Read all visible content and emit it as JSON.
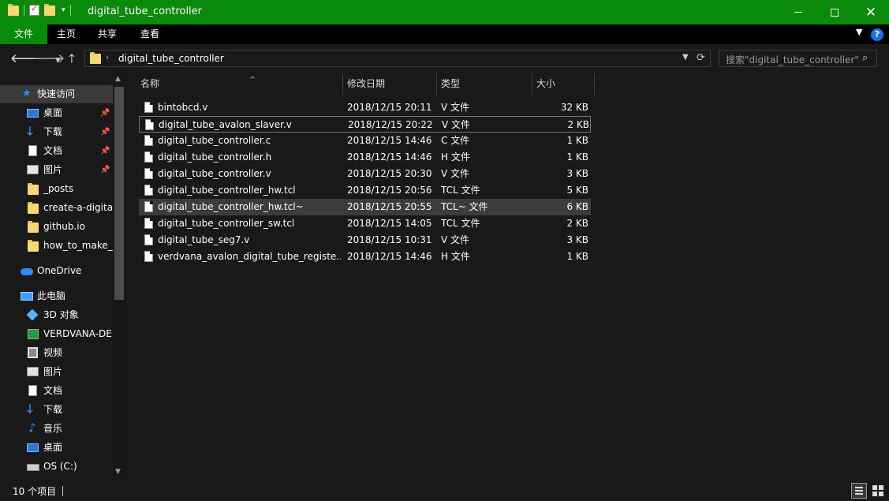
{
  "window": {
    "title": "digital_tube_controller",
    "close_glyph": "✕"
  },
  "ribbon": {
    "tabs": [
      "文件",
      "主页",
      "共享",
      "查看"
    ],
    "help": "?"
  },
  "address": {
    "path": "digital_tube_controller",
    "search_placeholder": "搜索\"digital_tube_controller\""
  },
  "sidebar": {
    "quick_access": "快速访问",
    "pinned": [
      {
        "label": "桌面",
        "icon": "desktop-icon"
      },
      {
        "label": "下载",
        "icon": "download-icon"
      },
      {
        "label": "文档",
        "icon": "document-icon"
      },
      {
        "label": "图片",
        "icon": "picture-icon"
      }
    ],
    "folders": [
      "_posts",
      "create-a-digita",
      "github.io",
      "how_to_make_v"
    ],
    "onedrive": "OneDrive",
    "this_pc": "此电脑",
    "pc_items": [
      {
        "label": "3D 对象",
        "icon": "3d-objects-icon"
      },
      {
        "label": "VERDVANA-DE",
        "icon": "verdvana-icon"
      },
      {
        "label": "视频",
        "icon": "video-icon"
      },
      {
        "label": "图片",
        "icon": "picture-icon"
      },
      {
        "label": "文档",
        "icon": "document-icon"
      },
      {
        "label": "下载",
        "icon": "download-icon"
      },
      {
        "label": "音乐",
        "icon": "music-icon"
      },
      {
        "label": "桌面",
        "icon": "desktop-icon"
      },
      {
        "label": "OS (C:)",
        "icon": "drive-icon"
      }
    ]
  },
  "columns": {
    "name": "名称",
    "date": "修改日期",
    "type": "类型",
    "size": "大小"
  },
  "files": [
    {
      "name": "bintobcd.v",
      "date": "2018/12/15 20:11",
      "type": "V 文件",
      "size": "32 KB"
    },
    {
      "name": "digital_tube_avalon_slaver.v",
      "date": "2018/12/15 20:22",
      "type": "V 文件",
      "size": "2 KB"
    },
    {
      "name": "digital_tube_controller.c",
      "date": "2018/12/15 14:46",
      "type": "C 文件",
      "size": "1 KB"
    },
    {
      "name": "digital_tube_controller.h",
      "date": "2018/12/15 14:46",
      "type": "H 文件",
      "size": "1 KB"
    },
    {
      "name": "digital_tube_controller.v",
      "date": "2018/12/15 20:30",
      "type": "V 文件",
      "size": "3 KB"
    },
    {
      "name": "digital_tube_controller_hw.tcl",
      "date": "2018/12/15 20:56",
      "type": "TCL 文件",
      "size": "5 KB"
    },
    {
      "name": "digital_tube_controller_hw.tcl~",
      "date": "2018/12/15 20:55",
      "type": "TCL~ 文件",
      "size": "6 KB"
    },
    {
      "name": "digital_tube_controller_sw.tcl",
      "date": "2018/12/15 14:05",
      "type": "TCL 文件",
      "size": "2 KB"
    },
    {
      "name": "digital_tube_seg7.v",
      "date": "2018/12/15 10:31",
      "type": "V 文件",
      "size": "3 KB"
    },
    {
      "name": "verdvana_avalon_digital_tube_registe...",
      "date": "2018/12/15 14:46",
      "type": "H 文件",
      "size": "1 KB"
    }
  ],
  "status": {
    "item_count": "10 个项目"
  },
  "colors": {
    "titlebar": "#0a8a0a",
    "background": "#191919",
    "selected_row": "#3c3c3c",
    "accent": "#2b8cff"
  }
}
